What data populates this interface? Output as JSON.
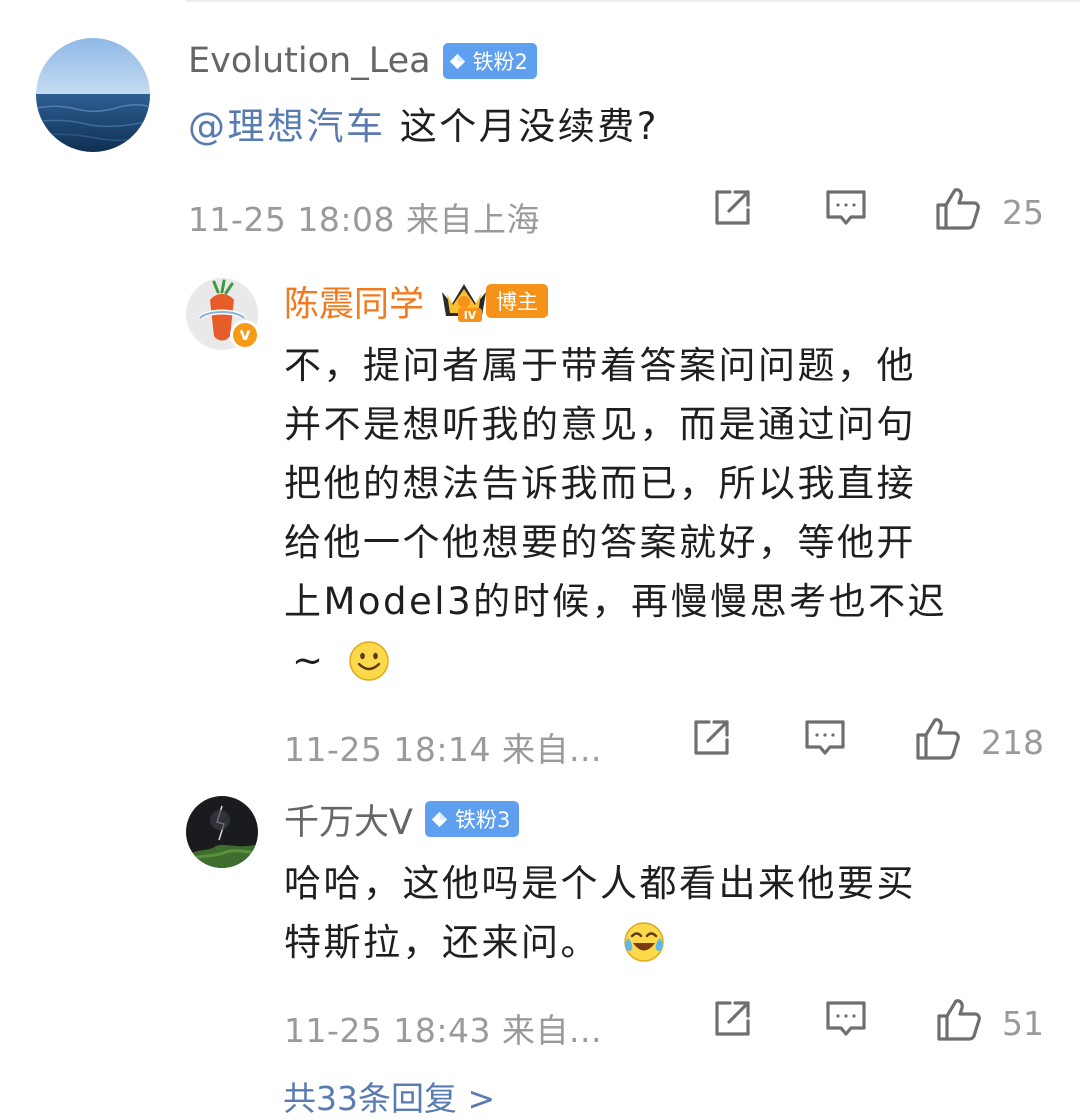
{
  "comments": [
    {
      "username": "Evolution_Lea",
      "badge_label": "铁粉2",
      "mention": "@理想汽车",
      "text": " 这个月没续费?",
      "timestamp": "11-25 18:08  来自上海",
      "likes": "25"
    },
    {
      "username": "陈震同学",
      "crown_label": "IV",
      "badge_label": "博主",
      "verified_label": "v",
      "text_lines": [
        "不，提问者属于带着答案问问题，他",
        "并不是想听我的意见，而是通过问句",
        "把他的想法告诉我而已，所以我直接",
        "给他一个他想要的答案就好，等他开",
        "上Model3的时候，再慢慢思考也不迟",
        "~"
      ],
      "timestamp": "11-25 18:14  来自...",
      "likes": "218"
    },
    {
      "username": "千万大V",
      "badge_label": "铁粉3",
      "text_lines": [
        "哈哈，这他吗是个人都看出来他要买",
        "特斯拉，还来问。"
      ],
      "timestamp": "11-25 18:43  来自...",
      "likes": "51"
    }
  ],
  "more_replies": "共33条回复 >",
  "icons": {
    "share": "share-icon",
    "comment": "comment-icon",
    "like": "thumbs-up-icon",
    "smile": "smile-emoji-icon",
    "laugh_cry": "laugh-cry-emoji-icon"
  },
  "colors": {
    "username_gray": "#666666",
    "username_orange": "#f07a1d",
    "mention_blue": "#587bb0",
    "fan_badge": "#5f9ff0",
    "blogger_badge": "#f59219",
    "meta_gray": "#9a9a9a"
  }
}
